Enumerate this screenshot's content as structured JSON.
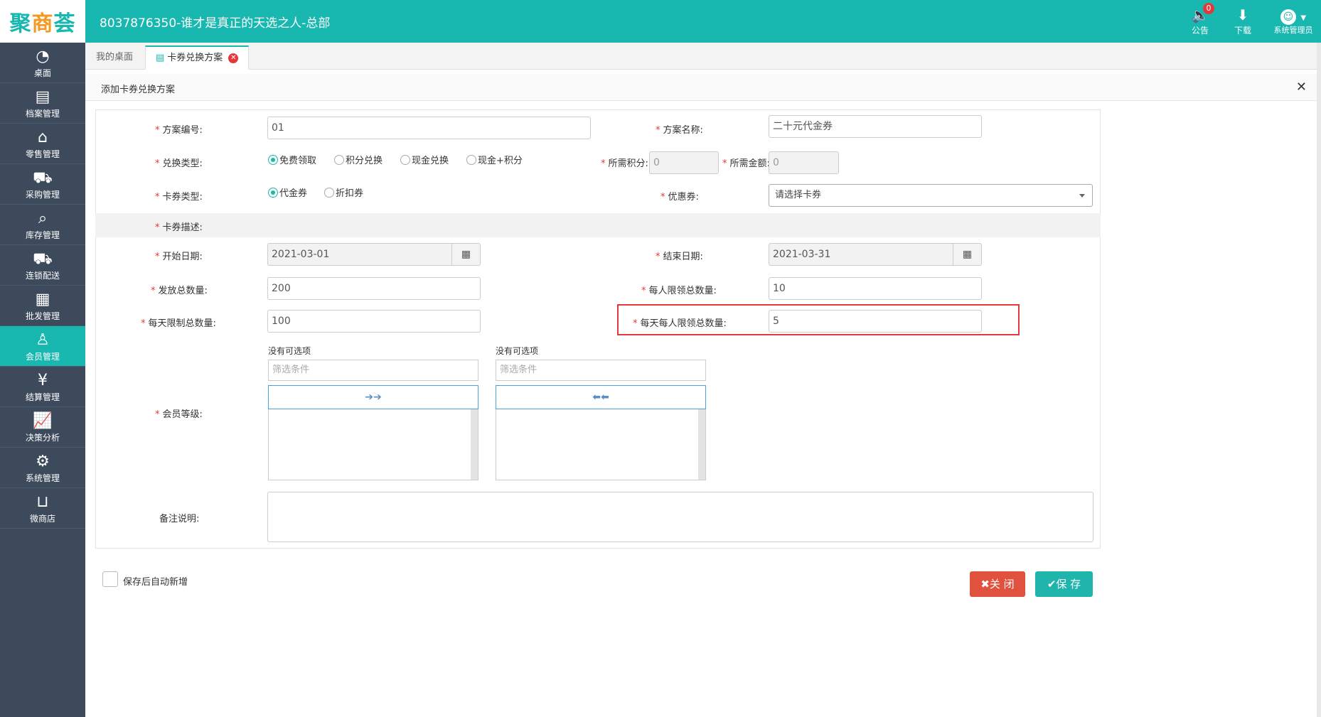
{
  "header": {
    "logo_main": "聚",
    "logo_accent": "商",
    "logo_tail": "荟",
    "company": "8037876350-谁才是真正的天选之人-总部",
    "notice_label": "公告",
    "notice_badge": "0",
    "download_label": "下载",
    "user_label": "系统管理员"
  },
  "sidebar": {
    "items": [
      {
        "label": "桌面",
        "icon": "dashboard-icon"
      },
      {
        "label": "档案管理",
        "icon": "file-icon"
      },
      {
        "label": "零售管理",
        "icon": "store-icon"
      },
      {
        "label": "采购管理",
        "icon": "cart-icon"
      },
      {
        "label": "库存管理",
        "icon": "inventory-icon"
      },
      {
        "label": "连锁配送",
        "icon": "truck-icon"
      },
      {
        "label": "批发管理",
        "icon": "wholesale-icon"
      },
      {
        "label": "会员管理",
        "icon": "member-icon"
      },
      {
        "label": "结算管理",
        "icon": "yen-icon"
      },
      {
        "label": "决策分析",
        "icon": "chart-icon"
      },
      {
        "label": "系统管理",
        "icon": "gear-icon"
      },
      {
        "label": "微商店",
        "icon": "shop-bag-icon"
      }
    ],
    "active_index": 7
  },
  "tabs": {
    "home": "我的桌面",
    "active": "卡券兑换方案"
  },
  "panel": {
    "title": "添加卡券兑换方案"
  },
  "form": {
    "plan_no_label": "方案编号:",
    "plan_no_value": "01",
    "plan_name_label": "方案名称:",
    "plan_name_value": "二十元代金券",
    "exchange_type_label": "兑换类型:",
    "exchange_types": [
      "免费领取",
      "积分兑换",
      "现金兑换",
      "现金+积分"
    ],
    "required_points_label": "所需积分:",
    "required_points_value": "0",
    "required_amount_label": "所需金额:",
    "required_amount_value": "0",
    "card_type_label": "卡券类型:",
    "card_types": [
      "代金券",
      "折扣券"
    ],
    "coupon_label": "优惠券:",
    "coupon_placeholder": "请选择卡券",
    "desc_label": "卡券描述:",
    "start_date_label": "开始日期:",
    "start_date_value": "2021-03-01",
    "end_date_label": "结束日期:",
    "end_date_value": "2021-03-31",
    "total_qty_label": "发放总数量:",
    "total_qty_value": "200",
    "per_person_label": "每人限领总数量:",
    "per_person_value": "10",
    "daily_limit_label": "每天限制总数量:",
    "daily_limit_value": "100",
    "daily_per_person_label": "每天每人限领总数量:",
    "daily_per_person_value": "5",
    "member_level_label": "会员等级:",
    "dual_left_title": "没有可选项",
    "dual_right_title": "没有可选项",
    "dual_filter_placeholder": "筛选条件",
    "dual_move_right": "➔➔",
    "dual_move_left": "⬅⬅",
    "remarks_label": "备注说明:",
    "required_mark": "*"
  },
  "footer": {
    "auto_add_label": "保存后自动新增",
    "close_label": "✖关 闭",
    "save_label": "✔保 存"
  },
  "colors": {
    "brand": "#18b7b0",
    "sidebar": "#3c4a5b",
    "danger": "#e0523e",
    "highlight": "#e4393c"
  }
}
